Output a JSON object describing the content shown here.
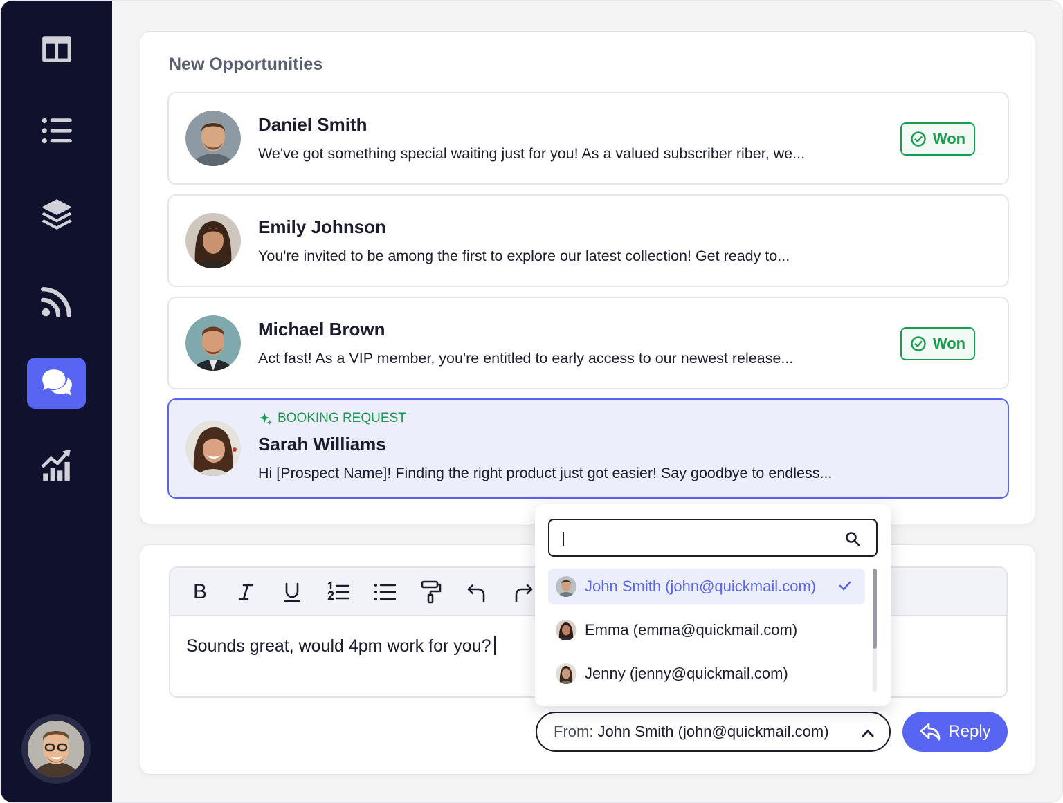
{
  "sidebar": {
    "items": [
      {
        "icon": "layout-icon",
        "active": false
      },
      {
        "icon": "list-icon",
        "active": false
      },
      {
        "icon": "layers-icon",
        "active": false
      },
      {
        "icon": "rss-icon",
        "active": false
      },
      {
        "icon": "chat-icon",
        "active": true
      },
      {
        "icon": "analytics-icon",
        "active": false
      }
    ],
    "user_avatar": "user-avatar"
  },
  "opportunities": {
    "title": "New Opportunities",
    "items": [
      {
        "name": "Daniel Smith",
        "message": "We've got something special waiting just for you! As a valued subscriber riber, we...",
        "status": "Won"
      },
      {
        "name": "Emily Johnson",
        "message": "You're invited to be among the first to explore our latest collection! Get ready to...",
        "status": ""
      },
      {
        "name": "Michael Brown",
        "message": "Act fast! As a VIP member, you're entitled to early access to our newest release...",
        "status": "Won"
      },
      {
        "name": "Sarah Williams",
        "message": "Hi [Prospect Name]! Finding the right product just got easier! Say goodbye to endless...",
        "tag": "BOOKING REQUEST",
        "selected": true
      }
    ]
  },
  "editor": {
    "toolbar": [
      "bold",
      "italic",
      "underline",
      "numbered-list",
      "bullet-list",
      "format-paint",
      "undo",
      "redo"
    ],
    "bold_label": "B",
    "body": "Sounds great, would 4pm work for you?"
  },
  "sender": {
    "label": "From:",
    "value": "John Smith (john@quickmail.com)"
  },
  "reply_button": {
    "label": "Reply"
  },
  "dropdown": {
    "search_value": "",
    "options": [
      {
        "label": "John Smith (john@quickmail.com)",
        "selected": true
      },
      {
        "label": "Emma (emma@quickmail.com)",
        "selected": false
      },
      {
        "label": "Jenny (jenny@quickmail.com)",
        "selected": false
      }
    ]
  },
  "colors": {
    "sidebar_bg": "#10112c",
    "accent": "#5865f2",
    "success": "#1a9c4e",
    "selected_row_bg": "#eceefc"
  }
}
